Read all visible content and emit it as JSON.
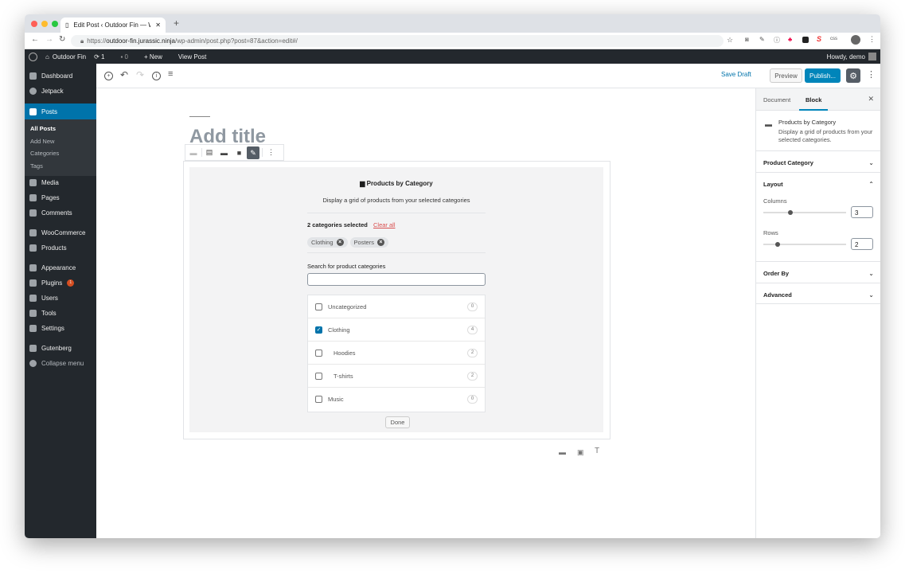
{
  "browser": {
    "tab_title": "Edit Post ‹ Outdoor Fin — Wor",
    "url_prefix": "https://",
    "url_host": "outdoor-fin.jurassic.ninja",
    "url_path": "/wp-admin/post.php?post=87&action=edit#/",
    "new_tab": "+"
  },
  "adminbar": {
    "site": "Outdoor Fin",
    "updates": "1",
    "comments": "0",
    "new": "New",
    "view_post": "View Post",
    "howdy": "Howdy, demo"
  },
  "sidebar": {
    "items": [
      {
        "label": "Dashboard"
      },
      {
        "label": "Jetpack"
      },
      {
        "label": "Posts"
      },
      {
        "label": "Media"
      },
      {
        "label": "Pages"
      },
      {
        "label": "Comments"
      },
      {
        "label": "WooCommerce"
      },
      {
        "label": "Products"
      },
      {
        "label": "Appearance"
      },
      {
        "label": "Plugins",
        "badge": "1"
      },
      {
        "label": "Users"
      },
      {
        "label": "Tools"
      },
      {
        "label": "Settings"
      },
      {
        "label": "Gutenberg"
      },
      {
        "label": "Collapse menu"
      }
    ],
    "posts_sub": [
      "All Posts",
      "Add New",
      "Categories",
      "Tags"
    ]
  },
  "toolbar": {
    "save_draft": "Save Draft",
    "preview": "Preview",
    "publish": "Publish..."
  },
  "editor": {
    "title_placeholder": "Add title",
    "block": {
      "title": "Products by Category",
      "description": "Display a grid of products from your selected categories",
      "selected_count": "2 categories selected",
      "clear_all": "Clear all",
      "chips": [
        "Clothing",
        "Posters"
      ],
      "search_label": "Search for product categories",
      "search_value": "",
      "categories": [
        {
          "name": "Uncategorized",
          "count": "0",
          "checked": false
        },
        {
          "name": "Clothing",
          "count": "4",
          "checked": true
        },
        {
          "name": "Hoodies",
          "count": "2",
          "checked": false
        },
        {
          "name": "T-shirts",
          "count": "2",
          "checked": false
        },
        {
          "name": "Music",
          "count": "0",
          "checked": false
        }
      ],
      "done": "Done"
    }
  },
  "panel": {
    "tabs": [
      "Document",
      "Block"
    ],
    "block_title": "Products by Category",
    "block_desc": "Display a grid of products from your selected categories.",
    "sections": {
      "product_category": "Product Category",
      "layout": "Layout",
      "order_by": "Order By",
      "advanced": "Advanced"
    },
    "columns_label": "Columns",
    "columns": "3",
    "columns_fraction": 0.33,
    "rows_label": "Rows",
    "rows": "2",
    "rows_fraction": 0.17
  },
  "colors": {
    "accent": "#0085ba",
    "admin_dark": "#23282d",
    "clear": "#d94f4f"
  }
}
